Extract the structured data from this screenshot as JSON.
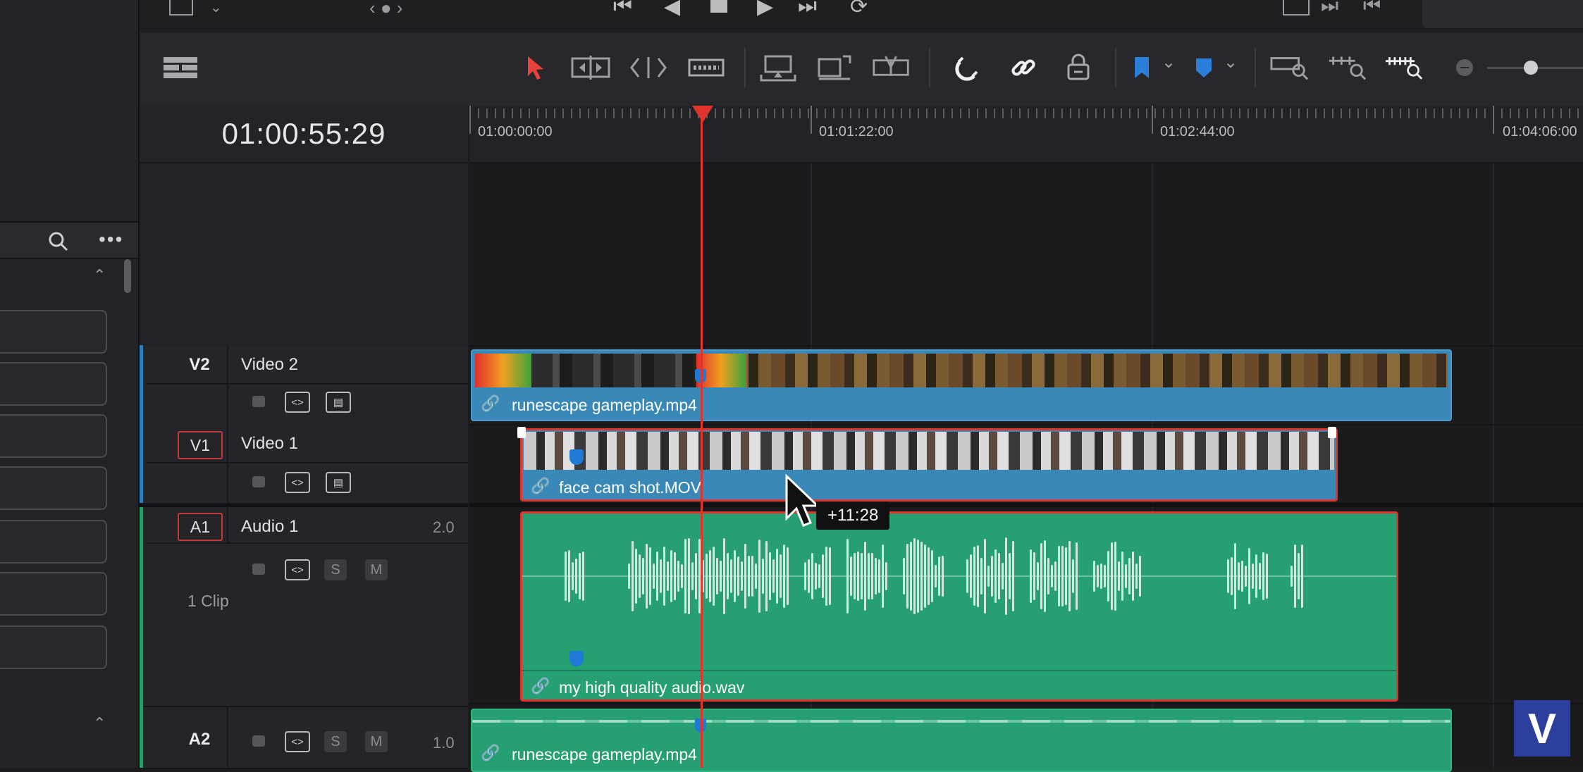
{
  "timecode": "01:00:55:29",
  "ruler_labels": [
    "01:00:00:00",
    "01:01:22:00",
    "01:02:44:00",
    "01:04:06:00"
  ],
  "tracks": {
    "v2": {
      "id": "V2",
      "name": "Video 2"
    },
    "v1": {
      "id": "V1",
      "name": "Video 1"
    },
    "a1": {
      "id": "A1",
      "name": "Audio 1",
      "level": "2.0",
      "clips": "1 Clip",
      "solo": "S",
      "mute": "M"
    },
    "a2": {
      "id": "A2",
      "level": "1.0",
      "solo": "S",
      "mute": "M"
    }
  },
  "clips": {
    "v2_clip": "runescape gameplay.mp4",
    "v1_clip": "face cam shot.MOV",
    "a1_clip": "my high quality audio.wav",
    "a2_clip": "runescape gameplay.mp4"
  },
  "drag_tooltip": "+11:28",
  "watermark": "V",
  "colors": {
    "playhead": "#e0342c",
    "video_clip": "#3a88b8",
    "audio_clip": "#26a072",
    "selection": "#e0342c",
    "marker": "#1e7ad6"
  },
  "icons": [
    "selection-arrow-icon",
    "trim-edit-icon",
    "dynamic-trim-icon",
    "blade-edit-icon",
    "insert-clip-icon",
    "overwrite-clip-icon",
    "replace-clip-icon",
    "snapping-icon",
    "linked-selection-icon",
    "position-lock-icon",
    "flag-icon",
    "marker-icon",
    "zoom-full-icon",
    "zoom-detail-icon",
    "zoom-custom-icon",
    "zoom-out-icon"
  ]
}
